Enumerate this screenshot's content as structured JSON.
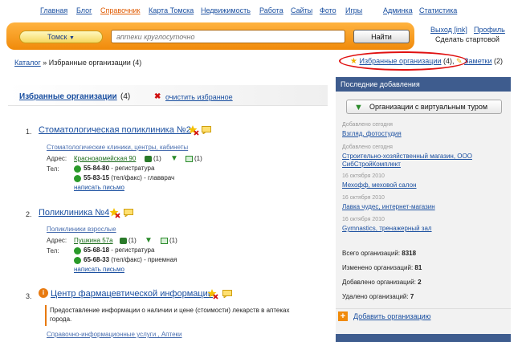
{
  "nav": {
    "items": [
      {
        "label": "Главная",
        "active": false
      },
      {
        "label": "Блог",
        "active": false
      },
      {
        "label": "Справочник",
        "active": true
      },
      {
        "label": "Карта Томска",
        "active": false
      },
      {
        "label": "Недвижимость",
        "active": false
      },
      {
        "label": "Работа",
        "active": false
      },
      {
        "label": "Сайты",
        "active": false
      },
      {
        "label": "Фото",
        "active": false
      },
      {
        "label": "Игры",
        "active": false
      },
      {
        "label": "Админка",
        "active": false
      },
      {
        "label": "Статистика",
        "active": false
      }
    ]
  },
  "search": {
    "city": "Томск",
    "query": "аптеки круглосуточно",
    "button": "Найти"
  },
  "user": {
    "logout": "Выход [ink]",
    "profile": "Профиль",
    "homepage": "Сделать стартовой"
  },
  "breadcrumb": {
    "root": "Каталог",
    "separator": "»",
    "current": "Избранные организации",
    "count": "(4)"
  },
  "top_links": {
    "favorites_label": "Избранные организации",
    "favorites_count": "(4),",
    "notes_label": "Заметки",
    "notes_count": "(2)"
  },
  "favorites": {
    "title": "Избранные организации",
    "count": "(4)",
    "clear": "очистить избранное"
  },
  "orgs": [
    {
      "num": "1.",
      "title": "Стоматологическая поликлиника №2",
      "category": "Стоматологические клиники, центры, кабинеты",
      "address_label": "Адрес:",
      "address": "Красноармейская 90",
      "photos": "(1)",
      "reviews": "(1)",
      "phone_label": "Тел:",
      "phones": [
        {
          "number": "55-84-80",
          "note": "- регистратура"
        },
        {
          "number": "55-83-15",
          "note": "(тел/факс) - главврач"
        }
      ],
      "mail": "написать письмо"
    },
    {
      "num": "2.",
      "title": "Поликлиника №4",
      "category": "Поликлиники взрослые",
      "address_label": "Адрес:",
      "address": "Пушкина 57а",
      "photos": "(1)",
      "reviews": "(1)",
      "phone_label": "Тел:",
      "phones": [
        {
          "number": "65-68-18",
          "note": "- регистратура"
        },
        {
          "number": "65-68-33",
          "note": "(тел/факс) - приемная"
        }
      ],
      "mail": "написать письмо"
    },
    {
      "num": "3.",
      "title": "Центр фармацевтической информации",
      "description": "Предоставление информации о наличии и цене (стоимости) лекарств в аптеках города.",
      "category": "Справочно-информационные услуги , Аптеки"
    }
  ],
  "sidebar": {
    "title": "Последние добавления",
    "virtual_tour_button": "Организации с виртуальным туром",
    "recent": [
      {
        "date": "Добавлено сегодня",
        "name": "Взгляд, фотостудия"
      },
      {
        "date": "Добавлено сегодня",
        "name": "Строительно-хозяйственный магазин, ООО"
      },
      {
        "date": "",
        "name": "СибСтройКомплект"
      },
      {
        "date": "16 октября 2010",
        "name": "Мехофф, меховой салон"
      },
      {
        "date": "16 октября 2010",
        "name": "Лавка чудес, интернет-магазин"
      },
      {
        "date": "16 октября 2010",
        "name": "Gymnastics, тренажерный зал"
      }
    ],
    "stats": [
      {
        "label": "Всего организаций:",
        "value": "8318"
      },
      {
        "label": "Изменено организаций:",
        "value": "81"
      },
      {
        "label": "Добавлено организаций:",
        "value": "2"
      },
      {
        "label": "Удалено организаций:",
        "value": "7"
      }
    ],
    "add_org": "Добавить организацию"
  },
  "colors": {
    "accent_orange": "#f08a0a",
    "link_blue": "#1a4fa0",
    "sidebar_header": "#3e5c8e",
    "highlight_ring": "#e01010"
  }
}
